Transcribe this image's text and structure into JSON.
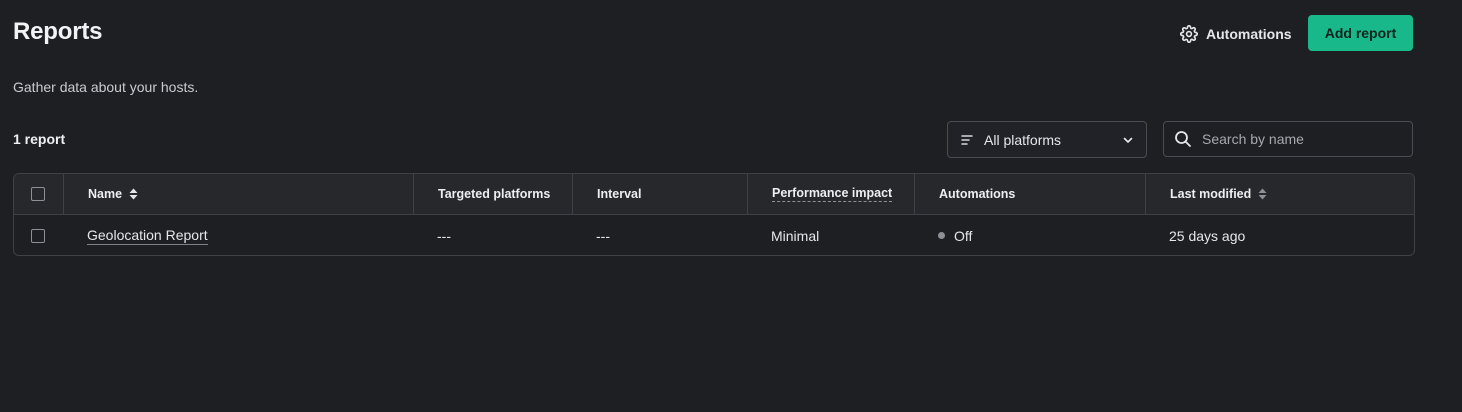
{
  "header": {
    "title": "Reports",
    "automations_label": "Automations",
    "add_report_label": "Add report"
  },
  "subtitle": "Gather data about your hosts.",
  "report_count": "1 report",
  "filters": {
    "platform_selected": "All platforms",
    "search_placeholder": "Search by name"
  },
  "table": {
    "columns": {
      "name": "Name",
      "targeted_platforms": "Targeted platforms",
      "interval": "Interval",
      "performance_impact": "Performance impact",
      "automations": "Automations",
      "last_modified": "Last modified"
    },
    "rows": [
      {
        "name": "Geolocation Report",
        "targeted_platforms": "---",
        "interval": "---",
        "performance_impact": "Minimal",
        "automations": "Off",
        "last_modified": "25 days ago"
      }
    ]
  },
  "colors": {
    "background": "#1e1f23",
    "accent": "#18b88a",
    "border": "#3f4147",
    "header_row": "#26282c"
  },
  "icons": {
    "automations": "gear-icon",
    "platform_filter": "filter-lines-icon",
    "platform_dropdown": "chevron-down-icon",
    "search": "search-icon",
    "sort": "sort-icon",
    "status": "status-dot-icon"
  }
}
